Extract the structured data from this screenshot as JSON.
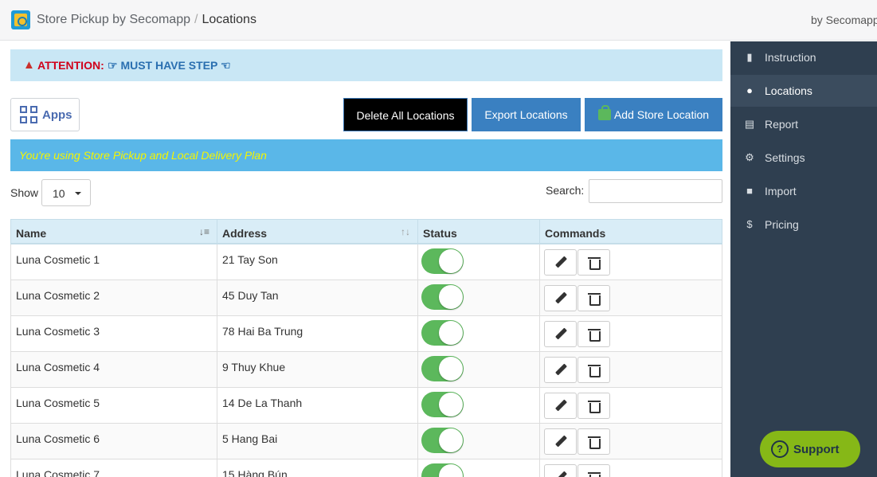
{
  "header": {
    "app_name": "Store Pickup by Secomapp",
    "separator": "/",
    "current_page": "Locations",
    "byline": "by Secomapp"
  },
  "sidebar": {
    "items": [
      {
        "label": "Instruction",
        "icon": "book-icon"
      },
      {
        "label": "Locations",
        "icon": "map-marker-icon",
        "active": true
      },
      {
        "label": "Report",
        "icon": "bar-chart-icon"
      },
      {
        "label": "Settings",
        "icon": "gear-icon"
      },
      {
        "label": "Import",
        "icon": "folder-open-icon"
      },
      {
        "label": "Pricing",
        "icon": "dollar-icon"
      }
    ],
    "support_label": "Support"
  },
  "attention": {
    "label": "ATTENTION:",
    "message": "☞ MUST HAVE STEP ☜"
  },
  "toolbar": {
    "apps_label": "Apps",
    "delete_all_label": "Delete All Locations",
    "export_label": "Export Locations",
    "add_label": "Add Store Location"
  },
  "plan_banner": "You're using Store Pickup and Local Delivery Plan",
  "list_controls": {
    "show_label": "Show",
    "page_size": "10",
    "search_label": "Search:",
    "search_value": ""
  },
  "table": {
    "columns": [
      "Name",
      "Address",
      "Status",
      "Commands"
    ],
    "rows": [
      {
        "name": "Luna Cosmetic 1",
        "address": "21 Tay Son",
        "enabled": true
      },
      {
        "name": "Luna Cosmetic 2",
        "address": "45 Duy Tan",
        "enabled": true
      },
      {
        "name": "Luna Cosmetic 3",
        "address": "78 Hai Ba Trung",
        "enabled": true
      },
      {
        "name": "Luna Cosmetic 4",
        "address": "9 Thuy Khue",
        "enabled": true
      },
      {
        "name": "Luna Cosmetic 5",
        "address": "14 De La Thanh",
        "enabled": true
      },
      {
        "name": "Luna Cosmetic 6",
        "address": "5 Hang Bai",
        "enabled": true
      },
      {
        "name": "Luna Cosmetic 7",
        "address": "15 Hàng Bún",
        "enabled": true
      }
    ]
  },
  "colors": {
    "sidebar_bg": "#2f3f50",
    "primary_button": "#3a80c1",
    "toggle_on": "#5cb85c",
    "support_bg": "#86b817",
    "attention_bg": "#c9e7f5",
    "plan_bg": "#5ab7e8"
  }
}
